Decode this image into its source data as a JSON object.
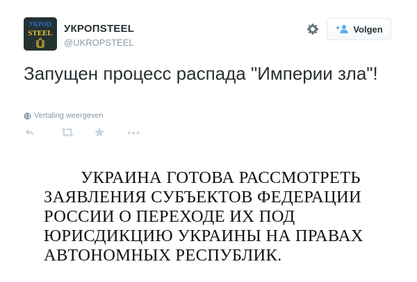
{
  "author": {
    "display_name": "УКРОПSTEEL",
    "handle": "@UKROPSTEEL",
    "avatar_text_top": "УКРОП",
    "avatar_text_bottom": "STEEL"
  },
  "follow_button": {
    "label": "Volgen"
  },
  "tweet": {
    "text": "Запущен процесс распада \"Империи зла\"!",
    "translate_label": "Vertaling weergeven"
  },
  "actions": {
    "icons": [
      "reply-icon",
      "retweet-icon",
      "favorite-icon",
      "more-icon"
    ]
  },
  "image": {
    "lines": [
      "УКРАИНА ГОТОВА РАССМОТРЕТЬ",
      "ЗАЯВЛЕНИЯ СУБЪЕКТОВ ФЕДЕРАЦИИ",
      "РОССИИ О ПЕРЕХОДЕ ИХ ПОД",
      "ЮРИСДИКЦИЮ УКРАИНЫ НА ПРАВАХ",
      "АВТОНОМНЫХ РЕСПУБЛИК."
    ]
  },
  "colors": {
    "text": "#292f33",
    "muted": "#8899a6",
    "icon": "#ccd6dd",
    "border": "#e1e8ed",
    "accent": "#55acee"
  }
}
